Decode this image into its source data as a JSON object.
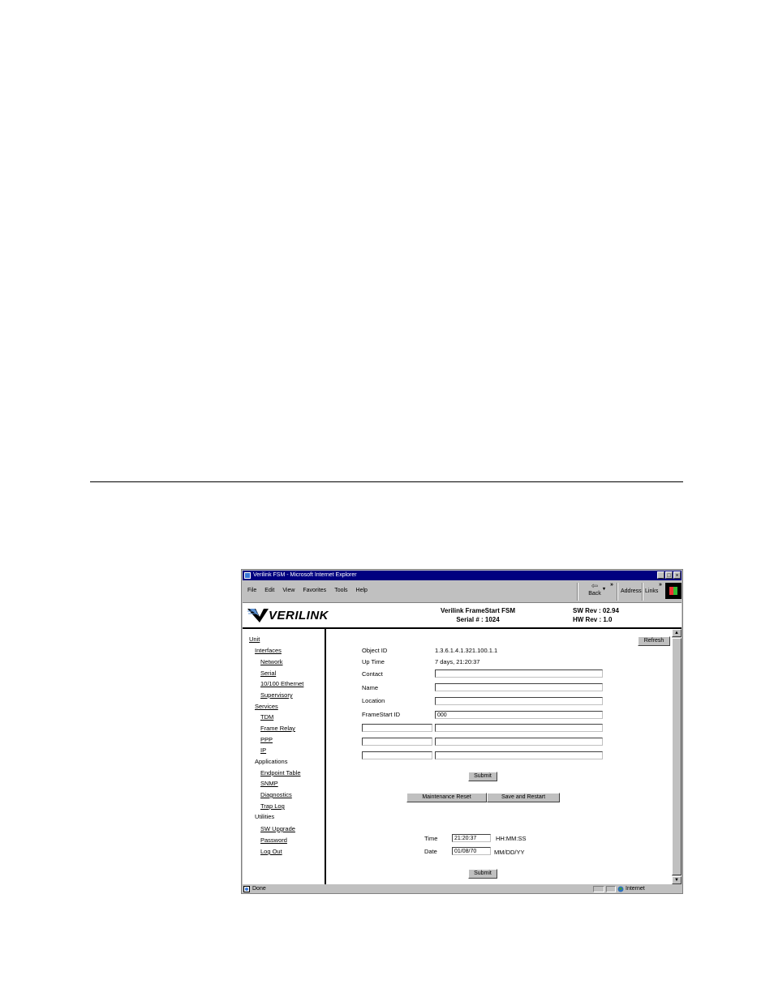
{
  "window": {
    "title": "Verilink FSM - Microsoft Internet Explorer",
    "controls": [
      "_",
      "□",
      "×"
    ]
  },
  "menu": [
    "File",
    "Edit",
    "View",
    "Favorites",
    "Tools",
    "Help"
  ],
  "toolbar": {
    "back_label": "Back",
    "address_label": "Address",
    "links_label": "Links",
    "more_glyph": "»"
  },
  "header": {
    "logo_text": "VERILINK",
    "product": "Verilink FrameStart FSM",
    "serial": "Serial # : 1024",
    "sw_rev": "SW Rev : 02.94",
    "hw_rev": "HW Rev : 1.0"
  },
  "sidebar": {
    "items": [
      {
        "label": "Unit",
        "level": 0,
        "link": true
      },
      {
        "label": "Interfaces",
        "level": 1,
        "link": true
      },
      {
        "label": "Network",
        "level": 2,
        "link": true
      },
      {
        "label": "Serial",
        "level": 2,
        "link": true
      },
      {
        "label": "10/100 Ethernet",
        "level": 2,
        "link": true
      },
      {
        "label": "Supervisory",
        "level": 2,
        "link": true
      },
      {
        "label": "Services",
        "level": 1,
        "link": true
      },
      {
        "label": "TDM",
        "level": 2,
        "link": true
      },
      {
        "label": "Frame Relay",
        "level": 2,
        "link": true
      },
      {
        "label": "PPP",
        "level": 2,
        "link": true
      },
      {
        "label": "IP",
        "level": 2,
        "link": true
      },
      {
        "label": "Applications",
        "level": 1,
        "link": false
      },
      {
        "label": "Endpoint Table",
        "level": 2,
        "link": true
      },
      {
        "label": "SNMP",
        "level": 2,
        "link": true
      },
      {
        "label": "Diagnostics",
        "level": 2,
        "link": true
      },
      {
        "label": "Trap Log",
        "level": 2,
        "link": true
      },
      {
        "label": "Utilities",
        "level": 1,
        "link": false
      },
      {
        "label": "SW Upgrade",
        "level": 2,
        "link": true
      },
      {
        "label": "Password",
        "level": 2,
        "link": true
      },
      {
        "label": "Log Out",
        "level": 2,
        "link": true
      }
    ]
  },
  "main": {
    "refresh_label": "Refresh",
    "object_id_label": "Object ID",
    "object_id_value": "1.3.6.1.4.1.321.100.1.1",
    "up_time_label": "Up Time",
    "up_time_value": "7 days, 21:20:37",
    "contact_label": "Contact",
    "contact_value": "",
    "name_label": "Name",
    "name_value": "",
    "location_label": "Location",
    "location_value": "",
    "framestart_id_label": "FrameStart  ID",
    "framestart_id_value": "000",
    "submit_label": "Submit",
    "maintenance_reset_label": "Maintenance Reset",
    "save_restart_label": "Save and Restart",
    "time_label": "Time",
    "time_value": "21:20:37",
    "time_format": "HH:MM:SS",
    "date_label": "Date",
    "date_value": "01/08/70",
    "date_format": "MM/DD/YY",
    "submit2_label": "Submit"
  },
  "status": {
    "text": "Done",
    "zone": "Internet"
  }
}
